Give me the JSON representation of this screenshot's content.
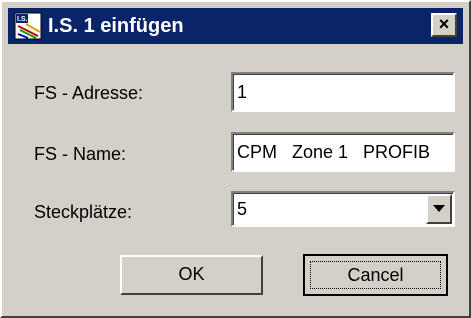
{
  "window": {
    "title": "I.S. 1 einfügen",
    "close_label": "×",
    "icon": "is-app-icon"
  },
  "form": {
    "address_label": "FS - Adresse:",
    "address_value": "1",
    "name_label": "FS - Name:",
    "name_value": "CPM   Zone 1   PROFIB",
    "slots_label": "Steckplätze:",
    "slots_value": "5"
  },
  "buttons": {
    "ok_label": "OK",
    "cancel_label": "Cancel"
  },
  "colors": {
    "titlebar": "#0a246a",
    "face": "#d4d0c8"
  }
}
